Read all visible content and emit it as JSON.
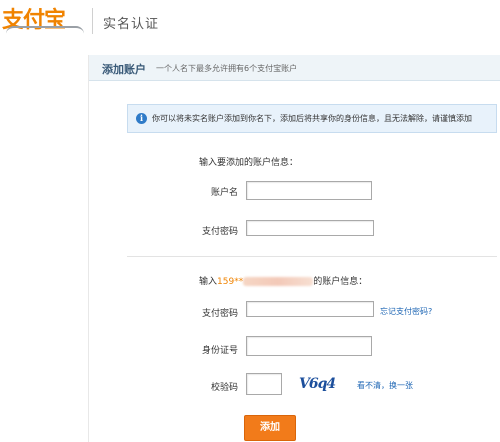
{
  "header": {
    "logo_text": "支付宝",
    "title": "实名认证"
  },
  "panel": {
    "title": "添加账户",
    "subtitle": "一个人名下最多允许拥有6个支付宝账户"
  },
  "notice": {
    "text": "你可以将未实名账户添加到你名下，添加后将共享你的身份信息，且无法解除，请谨慎添加"
  },
  "section1": {
    "heading": "输入要添加的账户信息：",
    "account_label": "账户名",
    "account_value": "",
    "password_label": "支付密码",
    "password_value": ""
  },
  "section2": {
    "heading_prefix": "输入",
    "phone_visible": "159**",
    "heading_suffix": "的账户信息：",
    "password_label": "支付密码",
    "password_value": "",
    "forgot_link": "忘记支付密码?",
    "id_label": "身份证号",
    "id_value": "",
    "captcha_label": "校验码",
    "captcha_value": "",
    "captcha_image_text": "V6q4",
    "refresh_link": "看不清，换一张"
  },
  "submit": {
    "label": "添加"
  },
  "colors": {
    "brand_orange": "#f08300",
    "button_orange": "#f27b1a",
    "link_blue": "#1e66b4",
    "notice_bg": "#e8f2fb"
  }
}
